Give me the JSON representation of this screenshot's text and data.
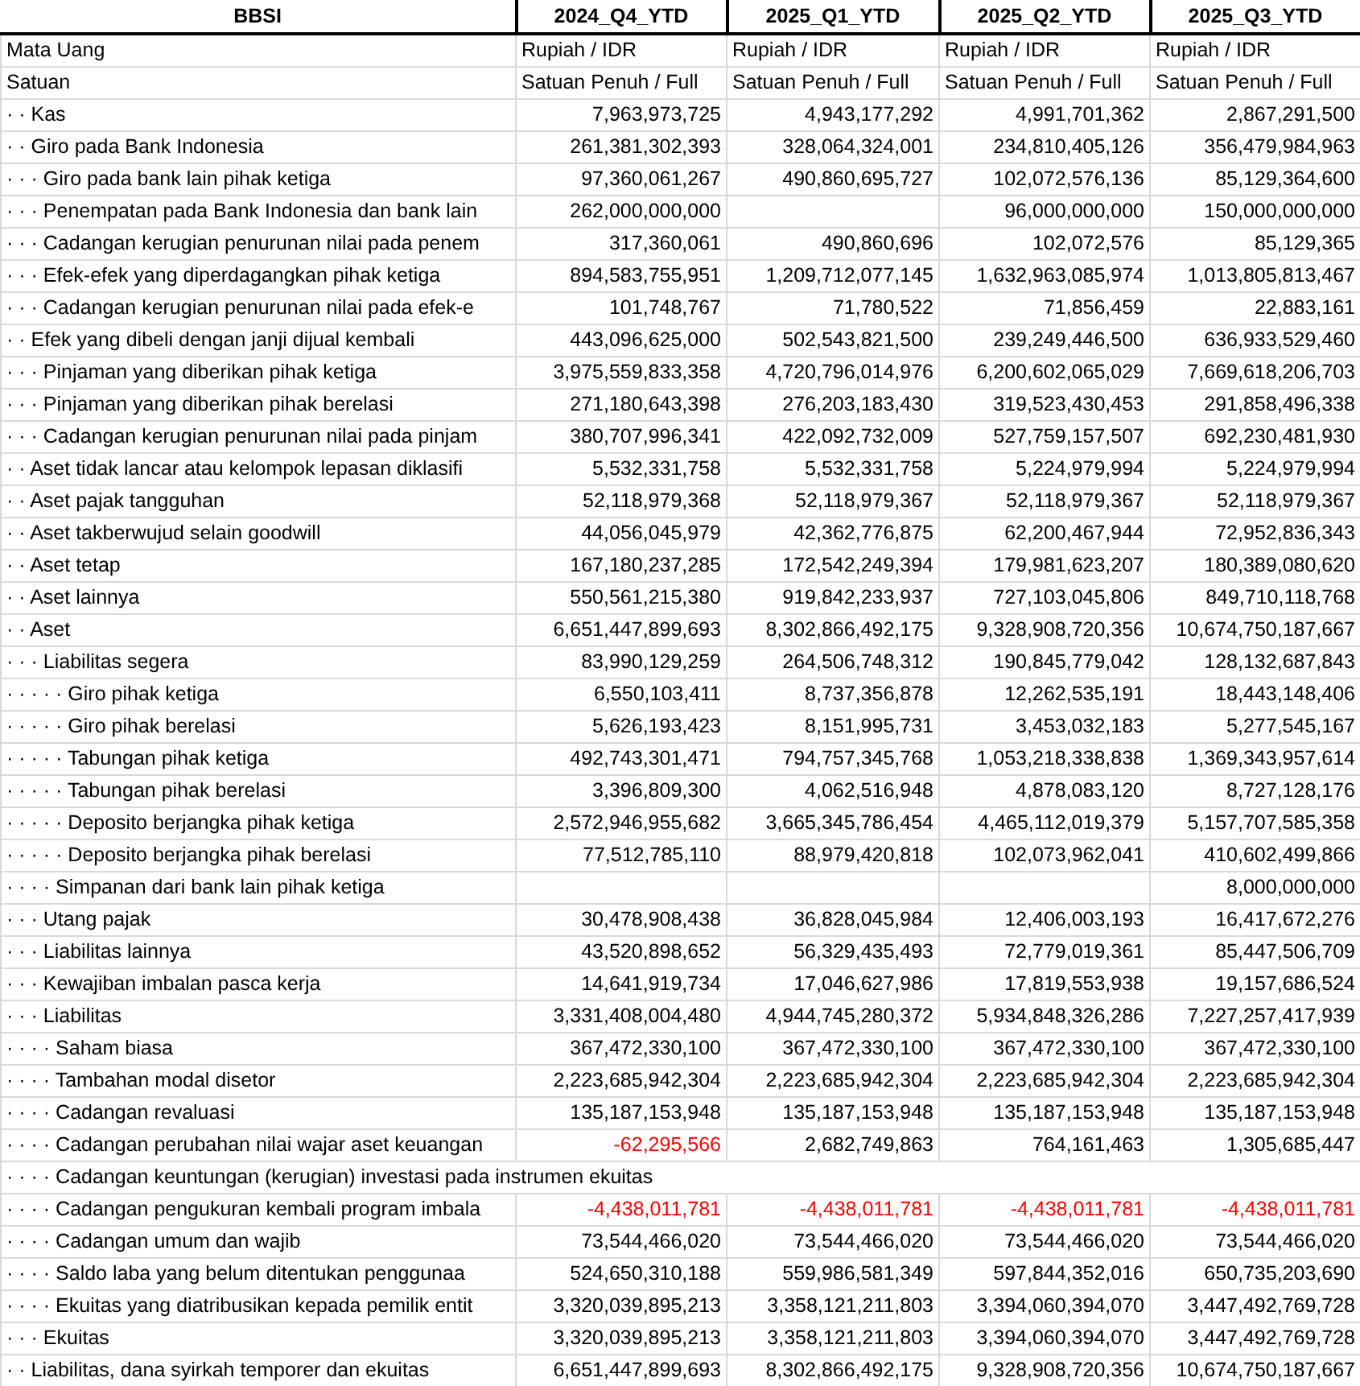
{
  "columns": [
    "BBSI",
    "2024_Q4_YTD",
    "2025_Q1_YTD",
    "2025_Q2_YTD",
    "2025_Q3_YTD"
  ],
  "rows": [
    {
      "kind": "meta",
      "label": "Mata Uang",
      "values": [
        "Rupiah / IDR",
        "Rupiah / IDR",
        "Rupiah / IDR",
        "Rupiah / IDR"
      ]
    },
    {
      "kind": "meta",
      "label": "Satuan",
      "values": [
        "Satuan Penuh / Full",
        "Satuan Penuh / Full",
        "Satuan Penuh / Full",
        "Satuan Penuh / Full"
      ]
    },
    {
      "kind": "line",
      "label": "· · Kas",
      "values": [
        "7,963,973,725",
        "4,943,177,292",
        "4,991,701,362",
        "2,867,291,500"
      ]
    },
    {
      "kind": "line",
      "label": "· · Giro pada Bank Indonesia",
      "values": [
        "261,381,302,393",
        "328,064,324,001",
        "234,810,405,126",
        "356,479,984,963"
      ]
    },
    {
      "kind": "line",
      "label": "· · · Giro pada bank lain pihak ketiga",
      "values": [
        "97,360,061,267",
        "490,860,695,727",
        "102,072,576,136",
        "85,129,364,600"
      ]
    },
    {
      "kind": "line",
      "label": "· · · Penempatan pada Bank Indonesia dan bank lain",
      "cells": {
        "c1": "262,000,000,000",
        "c3": "96,000,000,000",
        "c4": "150,000,000,000"
      }
    },
    {
      "kind": "line",
      "label": "· · · Cadangan kerugian penurunan nilai pada penem",
      "values": [
        "317,360,061",
        "490,860,696",
        "102,072,576",
        "85,129,365"
      ]
    },
    {
      "kind": "line",
      "label": "· · · Efek-efek yang diperdagangkan pihak ketiga",
      "values": [
        "894,583,755,951",
        "1,209,712,077,145",
        "1,632,963,085,974",
        "1,013,805,813,467"
      ]
    },
    {
      "kind": "line",
      "label": "· · · Cadangan kerugian penurunan nilai pada efek-e",
      "values": [
        "101,748,767",
        "71,780,522",
        "71,856,459",
        "22,883,161"
      ]
    },
    {
      "kind": "line",
      "label": "· · Efek yang dibeli dengan janji dijual kembali",
      "values": [
        "443,096,625,000",
        "502,543,821,500",
        "239,249,446,500",
        "636,933,529,460"
      ]
    },
    {
      "kind": "line",
      "label": "· · · Pinjaman yang diberikan pihak ketiga",
      "values": [
        "3,975,559,833,358",
        "4,720,796,014,976",
        "6,200,602,065,029",
        "7,669,618,206,703"
      ]
    },
    {
      "kind": "line",
      "label": "· · · Pinjaman yang diberikan pihak berelasi",
      "values": [
        "271,180,643,398",
        "276,203,183,430",
        "319,523,430,453",
        "291,858,496,338"
      ]
    },
    {
      "kind": "line",
      "label": "· · · Cadangan kerugian penurunan nilai pada pinjam",
      "values": [
        "380,707,996,341",
        "422,092,732,009",
        "527,759,157,507",
        "692,230,481,930"
      ]
    },
    {
      "kind": "line",
      "label": "· · Aset tidak lancar atau kelompok lepasan diklasifi",
      "values": [
        "5,532,331,758",
        "5,532,331,758",
        "5,224,979,994",
        "5,224,979,994"
      ]
    },
    {
      "kind": "line",
      "label": "· · Aset pajak tangguhan",
      "values": [
        "52,118,979,368",
        "52,118,979,367",
        "52,118,979,367",
        "52,118,979,367"
      ]
    },
    {
      "kind": "line",
      "label": "· · Aset takberwujud selain goodwill",
      "values": [
        "44,056,045,979",
        "42,362,776,875",
        "62,200,467,944",
        "72,952,836,343"
      ]
    },
    {
      "kind": "line",
      "label": "· · Aset tetap",
      "values": [
        "167,180,237,285",
        "172,542,249,394",
        "179,981,623,207",
        "180,389,080,620"
      ]
    },
    {
      "kind": "line",
      "label": "· · Aset lainnya",
      "values": [
        "550,561,215,380",
        "919,842,233,937",
        "727,103,045,806",
        "849,710,118,768"
      ]
    },
    {
      "kind": "line",
      "label": "· · Aset",
      "values": [
        "6,651,447,899,693",
        "8,302,866,492,175",
        "9,328,908,720,356",
        "10,674,750,187,667"
      ]
    },
    {
      "kind": "line",
      "label": "· · · Liabilitas segera",
      "values": [
        "83,990,129,259",
        "264,506,748,312",
        "190,845,779,042",
        "128,132,687,843"
      ]
    },
    {
      "kind": "line",
      "label": "· · · · · Giro pihak ketiga",
      "values": [
        "6,550,103,411",
        "8,737,356,878",
        "12,262,535,191",
        "18,443,148,406"
      ]
    },
    {
      "kind": "line",
      "label": "· · · · · Giro pihak berelasi",
      "values": [
        "5,626,193,423",
        "8,151,995,731",
        "3,453,032,183",
        "5,277,545,167"
      ]
    },
    {
      "kind": "line",
      "label": "· · · · · Tabungan pihak ketiga",
      "values": [
        "492,743,301,471",
        "794,757,345,768",
        "1,053,218,338,838",
        "1,369,343,957,614"
      ]
    },
    {
      "kind": "line",
      "label": "· · · · · Tabungan pihak berelasi",
      "values": [
        "3,396,809,300",
        "4,062,516,948",
        "4,878,083,120",
        "8,727,128,176"
      ]
    },
    {
      "kind": "line",
      "label": "· · · · · Deposito berjangka pihak ketiga",
      "values": [
        "2,572,946,955,682",
        "3,665,345,786,454",
        "4,465,112,019,379",
        "5,157,707,585,358"
      ]
    },
    {
      "kind": "line",
      "label": "· · · · · Deposito berjangka pihak berelasi",
      "values": [
        "77,512,785,110",
        "88,979,420,818",
        "102,073,962,041",
        "410,602,499,866"
      ]
    },
    {
      "kind": "line",
      "label": "· · · · Simpanan dari bank lain pihak ketiga",
      "cells": {
        "c4": "8,000,000,000"
      }
    },
    {
      "kind": "line",
      "label": "· · · Utang pajak",
      "values": [
        "30,478,908,438",
        "36,828,045,984",
        "12,406,003,193",
        "16,417,672,276"
      ]
    },
    {
      "kind": "line",
      "label": "· · · Liabilitas lainnya",
      "values": [
        "43,520,898,652",
        "56,329,435,493",
        "72,779,019,361",
        "85,447,506,709"
      ]
    },
    {
      "kind": "line",
      "label": "· · · Kewajiban imbalan pasca kerja",
      "values": [
        "14,641,919,734",
        "17,046,627,986",
        "17,819,553,938",
        "19,157,686,524"
      ]
    },
    {
      "kind": "line",
      "label": "· · · Liabilitas",
      "values": [
        "3,331,408,004,480",
        "4,944,745,280,372",
        "5,934,848,326,286",
        "7,227,257,417,939"
      ]
    },
    {
      "kind": "line",
      "label": "· · · · Saham biasa",
      "values": [
        "367,472,330,100",
        "367,472,330,100",
        "367,472,330,100",
        "367,472,330,100"
      ]
    },
    {
      "kind": "line",
      "label": "· · · · Tambahan modal disetor",
      "values": [
        "2,223,685,942,304",
        "2,223,685,942,304",
        "2,223,685,942,304",
        "2,223,685,942,304"
      ]
    },
    {
      "kind": "line",
      "label": "· · · · Cadangan revaluasi",
      "values": [
        "135,187,153,948",
        "135,187,153,948",
        "135,187,153,948",
        "135,187,153,948"
      ]
    },
    {
      "kind": "line",
      "label": "· · · · Cadangan perubahan nilai wajar aset keuangan",
      "values": [
        "-62,295,566",
        "2,682,749,863",
        "764,161,463",
        "1,305,685,447"
      ],
      "negative": [
        true,
        false,
        false,
        false
      ]
    },
    {
      "kind": "spanning",
      "label": "· · · · Cadangan keuntungan (kerugian) investasi pada instrumen ekuitas"
    },
    {
      "kind": "line",
      "label": "· · · · Cadangan pengukuran kembali program imbala",
      "values": [
        "-4,438,011,781",
        "-4,438,011,781",
        "-4,438,011,781",
        "-4,438,011,781"
      ],
      "negative": [
        true,
        true,
        true,
        true
      ]
    },
    {
      "kind": "line",
      "label": "· · · · Cadangan umum dan wajib",
      "values": [
        "73,544,466,020",
        "73,544,466,020",
        "73,544,466,020",
        "73,544,466,020"
      ]
    },
    {
      "kind": "line",
      "label": "· · · · Saldo laba yang belum ditentukan penggunaa",
      "values": [
        "524,650,310,188",
        "559,986,581,349",
        "597,844,352,016",
        "650,735,203,690"
      ]
    },
    {
      "kind": "line",
      "label": "· · · · Ekuitas yang diatribusikan kepada pemilik entit",
      "values": [
        "3,320,039,895,213",
        "3,358,121,211,803",
        "3,394,060,394,070",
        "3,447,492,769,728"
      ]
    },
    {
      "kind": "line",
      "label": "· · · Ekuitas",
      "values": [
        "3,320,039,895,213",
        "3,358,121,211,803",
        "3,394,060,394,070",
        "3,447,492,769,728"
      ]
    },
    {
      "kind": "line",
      "label": "· · Liabilitas, dana syirkah temporer dan ekuitas",
      "values": [
        "6,651,447,899,693",
        "8,302,866,492,175",
        "9,328,908,720,356",
        "10,674,750,187,667"
      ]
    }
  ]
}
